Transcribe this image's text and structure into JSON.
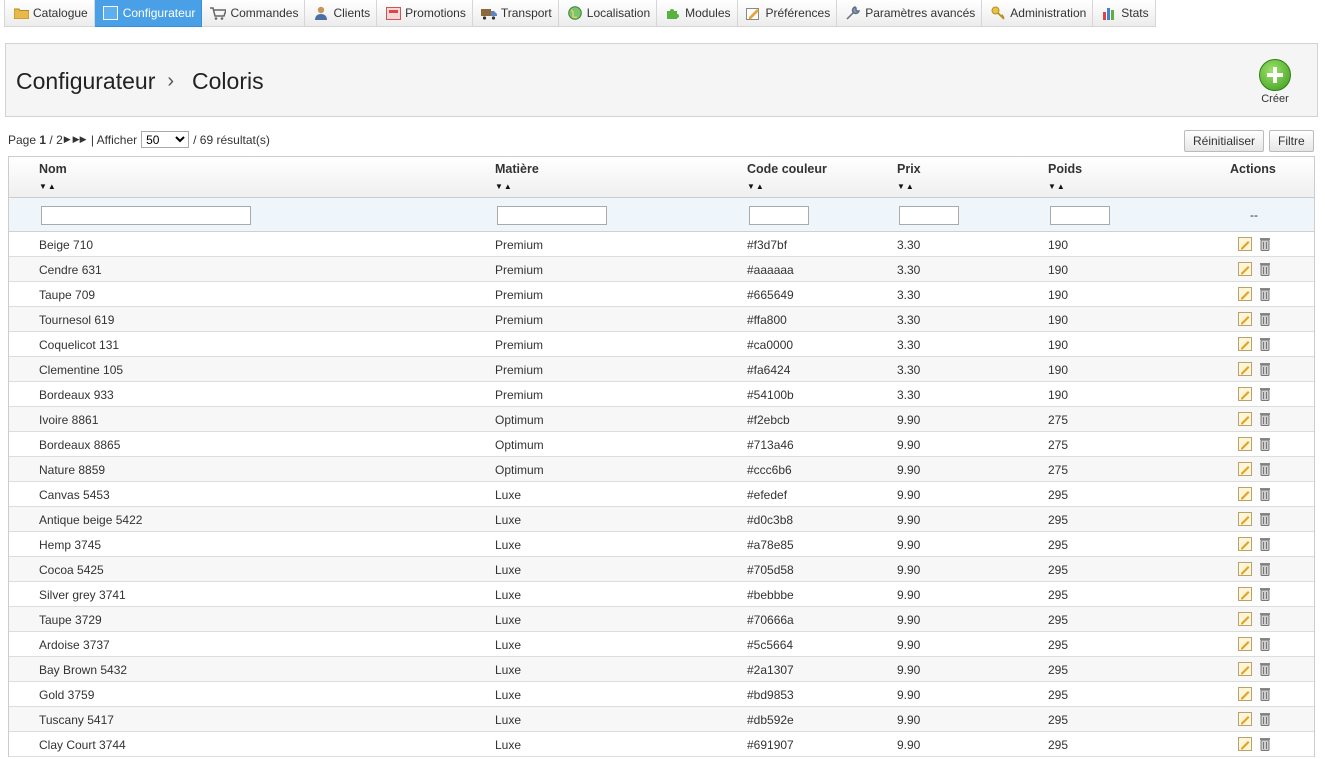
{
  "tabs": [
    {
      "label": "Catalogue",
      "icon": "folder-icon",
      "active": false
    },
    {
      "label": "Configurateur",
      "icon": "configurator-icon",
      "active": true
    },
    {
      "label": "Commandes",
      "icon": "cart-icon",
      "active": false
    },
    {
      "label": "Clients",
      "icon": "user-icon",
      "active": false
    },
    {
      "label": "Promotions",
      "icon": "promotion-icon",
      "active": false
    },
    {
      "label": "Transport",
      "icon": "truck-icon",
      "active": false
    },
    {
      "label": "Localisation",
      "icon": "globe-icon",
      "active": false
    },
    {
      "label": "Modules",
      "icon": "puzzle-icon",
      "active": false
    },
    {
      "label": "Préférences",
      "icon": "preferences-icon",
      "active": false
    },
    {
      "label": "Paramètres avancés",
      "icon": "wrench-icon",
      "active": false
    },
    {
      "label": "Administration",
      "icon": "key-icon",
      "active": false
    },
    {
      "label": "Stats",
      "icon": "bar-chart-icon",
      "active": false
    }
  ],
  "breadcrumb": {
    "parent": "Configurateur",
    "separator": "›",
    "current": "Coloris"
  },
  "toolbar": {
    "create_label": "Créer"
  },
  "pagination": {
    "page_label": "Page",
    "current_page": "1",
    "total_pages": "/ 2",
    "show_label": "| Afficher",
    "per_page": "50",
    "results": "/ 69 résultat(s)"
  },
  "buttons": {
    "reset": "Réinitialiser",
    "filter": "Filtre"
  },
  "table": {
    "columns": [
      "Nom",
      "Matière",
      "Code couleur",
      "Prix",
      "Poids",
      "Actions"
    ],
    "filter_placeholder_actions": "--",
    "rows": [
      [
        "Beige 710",
        "Premium",
        "#f3d7bf",
        "3.30",
        "190"
      ],
      [
        "Cendre 631",
        "Premium",
        "#aaaaaa",
        "3.30",
        "190"
      ],
      [
        "Taupe 709",
        "Premium",
        "#665649",
        "3.30",
        "190"
      ],
      [
        "Tournesol 619",
        "Premium",
        "#ffa800",
        "3.30",
        "190"
      ],
      [
        "Coquelicot 131",
        "Premium",
        "#ca0000",
        "3.30",
        "190"
      ],
      [
        "Clementine 105",
        "Premium",
        "#fa6424",
        "3.30",
        "190"
      ],
      [
        "Bordeaux 933",
        "Premium",
        "#54100b",
        "3.30",
        "190"
      ],
      [
        "Ivoire 8861",
        "Optimum",
        "#f2ebcb",
        "9.90",
        "275"
      ],
      [
        "Bordeaux 8865",
        "Optimum",
        "#713a46",
        "9.90",
        "275"
      ],
      [
        "Nature 8859",
        "Optimum",
        "#ccc6b6",
        "9.90",
        "275"
      ],
      [
        "Canvas 5453",
        "Luxe",
        "#efedef",
        "9.90",
        "295"
      ],
      [
        "Antique beige 5422",
        "Luxe",
        "#d0c3b8",
        "9.90",
        "295"
      ],
      [
        "Hemp 3745",
        "Luxe",
        "#a78e85",
        "9.90",
        "295"
      ],
      [
        "Cocoa 5425",
        "Luxe",
        "#705d58",
        "9.90",
        "295"
      ],
      [
        "Silver grey 3741",
        "Luxe",
        "#bebbbe",
        "9.90",
        "295"
      ],
      [
        "Taupe 3729",
        "Luxe",
        "#70666a",
        "9.90",
        "295"
      ],
      [
        "Ardoise 3737",
        "Luxe",
        "#5c5664",
        "9.90",
        "295"
      ],
      [
        "Bay Brown 5432",
        "Luxe",
        "#2a1307",
        "9.90",
        "295"
      ],
      [
        "Gold 3759",
        "Luxe",
        "#bd9853",
        "9.90",
        "295"
      ],
      [
        "Tuscany 5417",
        "Luxe",
        "#db592e",
        "9.90",
        "295"
      ],
      [
        "Clay Court 3744",
        "Luxe",
        "#691907",
        "9.90",
        "295"
      ]
    ]
  },
  "colors": {
    "active_tab": "#4aa0e6",
    "header_bg": "#f5f5f5",
    "filter_row_bg": "#eef6fc",
    "create_button": "#3b9a1b"
  }
}
